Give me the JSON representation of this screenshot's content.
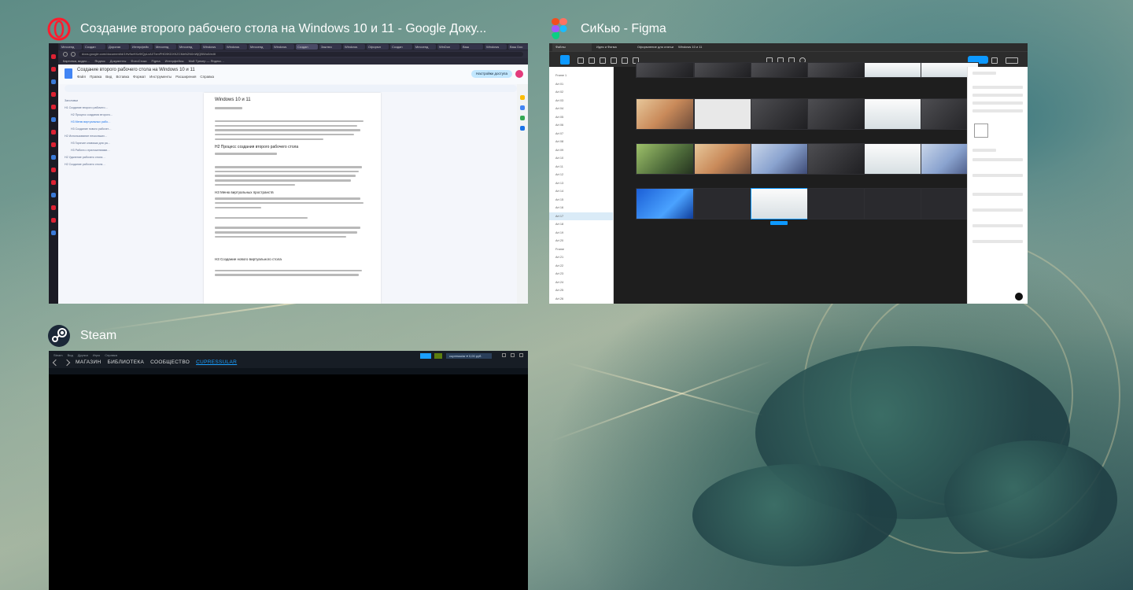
{
  "windows": [
    {
      "app": "Opera",
      "icon": "opera-icon",
      "title": "Создание второго рабочего стола на Windows 10 и 11 - Google Доку...",
      "content": {
        "browser_tabs": [
          "Мессенд",
          "Создан",
          "Дорогая",
          "Интерфейс",
          "Мессенд",
          "Мессенд",
          "Windows",
          "Windows",
          "Мессенд",
          "Windows",
          "Создан",
          "Заключ",
          "Windows",
          "Оформл",
          "Создан",
          "Мессенд",
          "WinDon",
          "Ваш",
          "Windows",
          "Ваш Doc",
          "WinDon",
          "Windows",
          "Ваш Doc"
        ],
        "address": "docs.google.com/document/d/1Hv9wHXz9fQpLvA0TxmPHD9KDXKZCMeN2N0nWjQBWu0/edit",
        "bookmarks": [
          "Картинки, видео…",
          "Яндекс",
          "Документы",
          "ФотоСтоки",
          "Figma",
          "Интерфейсы",
          "Мой Трекер — Яндекс…"
        ],
        "doc_title": "Создание второго рабочего стола на Windows 10 и 11",
        "doc_menu": [
          "Файл",
          "Правка",
          "Вид",
          "Вставка",
          "Формат",
          "Инструменты",
          "Расширения",
          "Справка"
        ],
        "share_label": "Настройки доступа",
        "outline": [
          {
            "text": "Заголовки",
            "indent": false,
            "active": false
          },
          {
            "text": "H1 Создание второго рабочего…",
            "indent": false,
            "active": false
          },
          {
            "text": "H2 Процесс создания второго…",
            "indent": true,
            "active": false
          },
          {
            "text": "H3 Меню виртуальных рабо…",
            "indent": true,
            "active": true
          },
          {
            "text": "H3 Создание нового рабочег…",
            "indent": true,
            "active": false
          },
          {
            "text": "H2 Использование нескольких…",
            "indent": false,
            "active": false
          },
          {
            "text": "H3 Горячие клавиши для ра…",
            "indent": true,
            "active": false
          },
          {
            "text": "H3 Работа с приложениями…",
            "indent": true,
            "active": false
          },
          {
            "text": "H2 Удаление рабочего стола…",
            "indent": false,
            "active": false
          },
          {
            "text": "H2 Создание рабочего стола…",
            "indent": false,
            "active": false
          }
        ],
        "page_heading": "Windows 10 и 11",
        "page_h2": "H2 Процесс создания второго рабочего стола",
        "page_h3_a": "H3 Меню виртуальных пространств",
        "page_h3_b": "H3 Создание нового виртуального стола"
      }
    },
    {
      "app": "Figma",
      "icon": "figma-icon",
      "title": "СиКью - Figma",
      "content": {
        "tabs": [
          "Файлы",
          "Идея и Фигма",
          "Оформление для статьи",
          "Windows 10 и 11"
        ],
        "page_labels": [
          "Слой 1",
          "Frame 3"
        ],
        "layers": [
          "Frame 1",
          "Art 01",
          "Art 02",
          "Art 03",
          "Art 04",
          "Art 05",
          "Art 06",
          "Art 07",
          "Art 08",
          "Art 09",
          "Art 10",
          "Art 11",
          "Art 12",
          "Art 13",
          "Art 14",
          "Art 15",
          "Art 16",
          "Art 17",
          "Art 18",
          "Art 19",
          "Art 20",
          "Frame",
          "Art 21",
          "Art 22",
          "Art 23",
          "Art 24",
          "Art 25",
          "Art 26",
          "Art 27",
          "Art 28",
          "Art 29",
          "Art 30",
          "Art 31",
          "Frame",
          "Art 32"
        ],
        "selected_layer_index": 17,
        "right_panel": [
          "Frame",
          "Позиция",
          "Слои",
          "Заливка",
          "Обводка",
          "Эффекты",
          "Экспорт"
        ]
      }
    },
    {
      "app": "Steam",
      "icon": "steam-icon",
      "title": "Steam",
      "content": {
        "menu": [
          "Steam",
          "Вид",
          "Друзья",
          "Игры",
          "Справка"
        ],
        "nav": [
          "МАГАЗИН",
          "БИБЛИОТЕКА",
          "СООБЩЕСТВО",
          "CUPRESSULAR"
        ],
        "nav_active_index": 3,
        "user": "cupressular ▾ 0,00 руб."
      }
    }
  ]
}
